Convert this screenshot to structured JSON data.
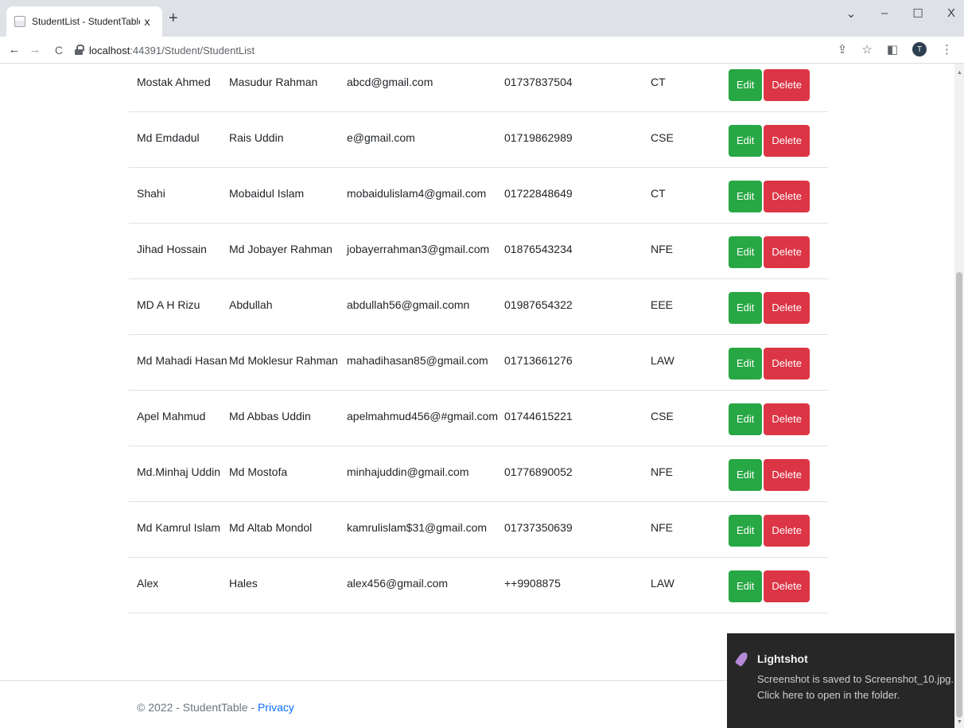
{
  "browser": {
    "tab_title": "StudentList - StudentTable",
    "tab_close": "x",
    "new_tab": "+",
    "url_host": "localhost",
    "url_path": ":44391/Student/StudentList",
    "window_controls": {
      "minimize": "–",
      "maximize": "☐",
      "close": "X",
      "menu": "⌄"
    },
    "avatar_initial": "T"
  },
  "table": {
    "edit_label": "Edit",
    "delete_label": "Delete",
    "rows": [
      {
        "first": "",
        "last": "",
        "email": "",
        "phone": "",
        "dept": ""
      },
      {
        "first": "Mostak Ahmed",
        "last": "Masudur Rahman",
        "email": "abcd@gmail.com",
        "phone": "01737837504",
        "dept": "CT"
      },
      {
        "first": "Md Emdadul",
        "last": "Rais Uddin",
        "email": "e@gmail.com",
        "phone": "01719862989",
        "dept": "CSE"
      },
      {
        "first": "Shahi",
        "last": "Mobaidul Islam",
        "email": "mobaidulislam4@gmail.com",
        "phone": "01722848649",
        "dept": "CT"
      },
      {
        "first": "Jihad Hossain",
        "last": "Md Jobayer Rahman",
        "email": "jobayerrahman3@gmail.com",
        "phone": "01876543234",
        "dept": "NFE"
      },
      {
        "first": "MD A H Rizu",
        "last": "Abdullah",
        "email": "abdullah56@gmail.comn",
        "phone": "01987654322",
        "dept": "EEE"
      },
      {
        "first": "Md Mahadi Hasan",
        "last": "Md Moklesur Rahman",
        "email": "mahadihasan85@gmail.com",
        "phone": "01713661276",
        "dept": "LAW"
      },
      {
        "first": "Apel Mahmud",
        "last": "Md Abbas Uddin",
        "email": "apelmahmud456@#gmail.com",
        "phone": "01744615221",
        "dept": "CSE"
      },
      {
        "first": "Md.Minhaj Uddin",
        "last": "Md Mostofa",
        "email": "minhajuddin@gmail.com",
        "phone": "01776890052",
        "dept": "NFE"
      },
      {
        "first": "Md Kamrul Islam",
        "last": "Md Altab Mondol",
        "email": "kamrulislam$31@gmail.com",
        "phone": "01737350639",
        "dept": "NFE"
      },
      {
        "first": "Alex",
        "last": "Hales",
        "email": "alex456@gmail.com",
        "phone": "++9908875",
        "dept": "LAW"
      }
    ]
  },
  "footer": {
    "text": "© 2022 - StudentTable - ",
    "privacy_link": "Privacy"
  },
  "toast": {
    "title": "Lightshot",
    "line1": "Screenshot is saved to Screenshot_10.jpg.",
    "line2": "Click here to open in the folder."
  }
}
